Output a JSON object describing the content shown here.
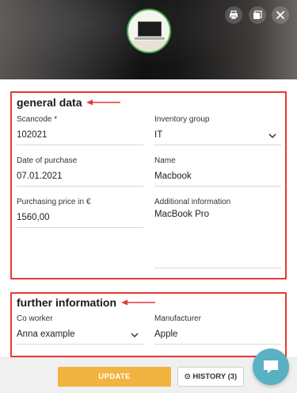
{
  "header": {
    "print_icon": "print-icon",
    "copy_icon": "copy-icon",
    "close_icon": "close-icon"
  },
  "general": {
    "title": "general data",
    "scancode": {
      "label": "Scancode *",
      "value": "102021"
    },
    "inventory_group": {
      "label": "Inventory group",
      "value": "IT"
    },
    "date_of_purchase": {
      "label": "Date of purchase",
      "value": "07.01.2021"
    },
    "name": {
      "label": "Name",
      "value": "Macbook"
    },
    "purchasing_price": {
      "label": "Purchasing price in €",
      "value": "1560,00"
    },
    "additional_info": {
      "label": "Additional information",
      "value": "MacBook Pro"
    }
  },
  "further": {
    "title": "further information",
    "co_worker": {
      "label": "Co worker",
      "value": "Anna example"
    },
    "manufacturer": {
      "label": "Manufacturer",
      "value": "Apple"
    }
  },
  "footer": {
    "update_label": "UPDATE",
    "history_label": "⊙ HISTORY (3)"
  },
  "colors": {
    "accent": "#f2b441",
    "highlight_border": "#e53935",
    "avatar_ring": "#4caf50",
    "chat": "#5ab1c4"
  }
}
